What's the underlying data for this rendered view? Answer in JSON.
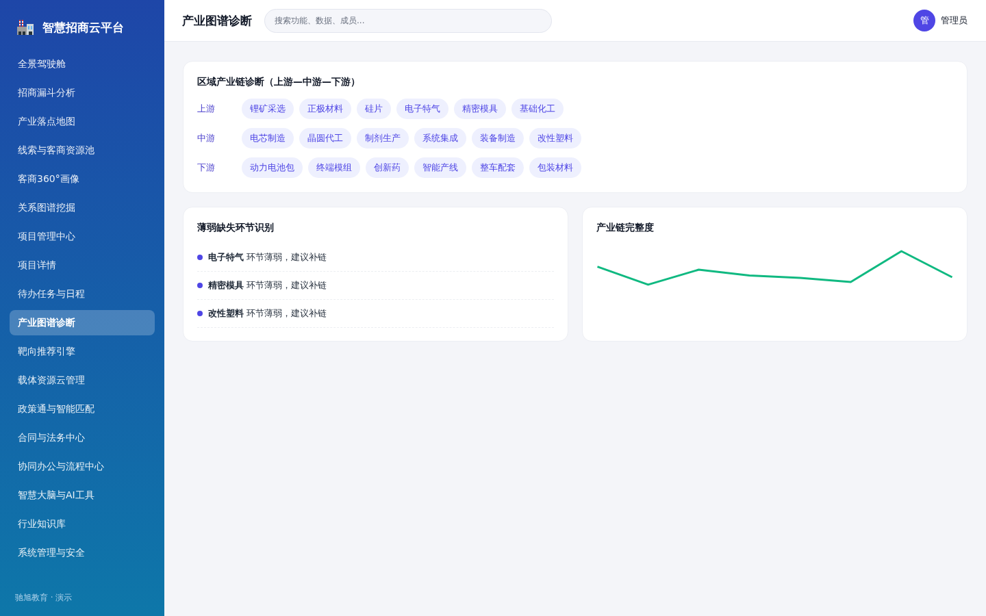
{
  "sidebar": {
    "brand": "智慧招商云平台",
    "items": [
      {
        "label": "全景驾驶舱",
        "selected": false
      },
      {
        "label": "招商漏斗分析",
        "selected": false
      },
      {
        "label": "产业落点地图",
        "selected": false
      },
      {
        "label": "线索与客商资源池",
        "selected": false
      },
      {
        "label": "客商360°画像",
        "selected": false
      },
      {
        "label": "关系图谱挖掘",
        "selected": false
      },
      {
        "label": "项目管理中心",
        "selected": false
      },
      {
        "label": "项目详情",
        "selected": false
      },
      {
        "label": "待办任务与日程",
        "selected": false
      },
      {
        "label": "产业图谱诊断",
        "selected": true
      },
      {
        "label": "靶向推荐引擎",
        "selected": false
      },
      {
        "label": "载体资源云管理",
        "selected": false
      },
      {
        "label": "政策通与智能匹配",
        "selected": false
      },
      {
        "label": "合同与法务中心",
        "selected": false
      },
      {
        "label": "协同办公与流程中心",
        "selected": false
      },
      {
        "label": "智慧大脑与AI工具",
        "selected": false
      },
      {
        "label": "行业知识库",
        "selected": false
      },
      {
        "label": "系统管理与安全",
        "selected": false
      }
    ],
    "footer": "驰旭教育 · 演示"
  },
  "topbar": {
    "title": "产业图谱诊断",
    "search": {
      "placeholder": "搜索功能、数据、成员..."
    },
    "user": {
      "avatar": "管",
      "name": "管理员"
    }
  },
  "chain_card": {
    "title": "区域产业链诊断（上游—中游—下游）",
    "rows": [
      {
        "stage": "上游",
        "nodes": [
          "锂矿采选",
          "正极材料",
          "硅片",
          "电子特气",
          "精密模具",
          "基础化工"
        ]
      },
      {
        "stage": "中游",
        "nodes": [
          "电芯制造",
          "晶圆代工",
          "制剂生产",
          "系统集成",
          "装备制造",
          "改性塑料"
        ]
      },
      {
        "stage": "下游",
        "nodes": [
          "动力电池包",
          "终端模组",
          "创新药",
          "智能产线",
          "整车配套",
          "包装材料"
        ]
      }
    ]
  },
  "weak_card": {
    "title": "薄弱缺失环节识别",
    "items": [
      "**电子特气** 环节薄弱，建议补链",
      "**精密模具** 环节薄弱，建议补链",
      "**改性塑料** 环节薄弱，建议补链"
    ]
  },
  "completeness_card": {
    "title": "产业链完整度"
  }
}
